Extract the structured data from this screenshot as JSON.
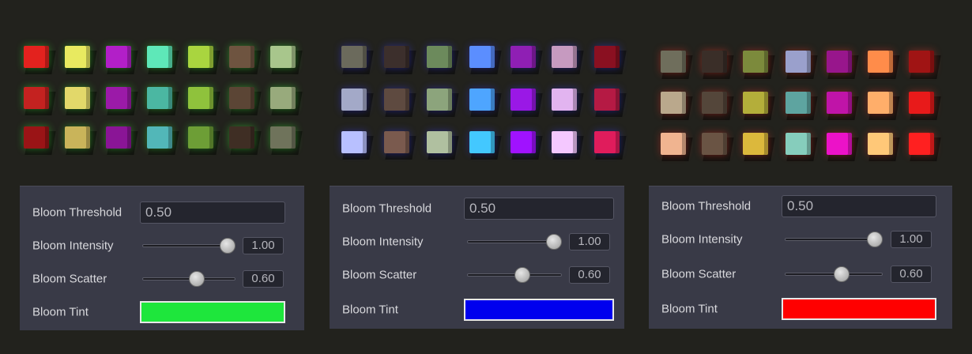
{
  "panels": [
    {
      "bloom_threshold": {
        "label": "Bloom Threshold",
        "value": "0.50"
      },
      "bloom_intensity": {
        "label": "Bloom Intensity",
        "value": "1.00",
        "fraction": 1.0
      },
      "bloom_scatter": {
        "label": "Bloom Scatter",
        "value": "0.60",
        "fraction": 0.6
      },
      "bloom_tint": {
        "label": "Bloom Tint",
        "color": "#1ee63c"
      },
      "cube_colors": [
        [
          "#e3221e",
          "#e8ea60",
          "#b21fc8",
          "#5ee8b8",
          "#a9d53f",
          "#6e5440",
          "#a8c68c"
        ],
        [
          "#c42220",
          "#e2d86a",
          "#9b1aa8",
          "#4bb7a2",
          "#8fc23c",
          "#5b4535",
          "#98aa7c"
        ],
        [
          "#9a1416",
          "#c9b45a",
          "#8a1596",
          "#52b7b8",
          "#6d9e36",
          "#3f2e24",
          "#6f735b"
        ]
      ],
      "glow": "#43ff3a"
    },
    {
      "bloom_threshold": {
        "label": "Bloom Threshold",
        "value": "0.50"
      },
      "bloom_intensity": {
        "label": "Bloom Intensity",
        "value": "1.00",
        "fraction": 1.0
      },
      "bloom_scatter": {
        "label": "Bloom Scatter",
        "value": "0.60",
        "fraction": 0.6
      },
      "bloom_tint": {
        "label": "Bloom Tint",
        "color": "#0000ee"
      },
      "cube_colors": [
        [
          "#6b6a5c",
          "#3c2f2c",
          "#6c8a5c",
          "#5b8eff",
          "#8f1fb4",
          "#c69ac0",
          "#8a1021"
        ],
        [
          "#a3a9c8",
          "#5e4a40",
          "#8ca47c",
          "#4ea5ff",
          "#9a18e6",
          "#e2b4f0",
          "#b51a44"
        ],
        [
          "#b8c0ff",
          "#7a5a4e",
          "#b0c0a0",
          "#43c8ff",
          "#a012ff",
          "#f4c8ff",
          "#e01c5c"
        ]
      ],
      "glow": "#3a3cff"
    },
    {
      "bloom_threshold": {
        "label": "Bloom Threshold",
        "value": "0.50"
      },
      "bloom_intensity": {
        "label": "Bloom Intensity",
        "value": "1.00",
        "fraction": 1.0
      },
      "bloom_scatter": {
        "label": "Bloom Scatter",
        "value": "0.60",
        "fraction": 0.6
      },
      "bloom_tint": {
        "label": "Bloom Tint",
        "color": "#ff0000"
      },
      "cube_colors": [
        [
          "#6f6e5c",
          "#3a2e28",
          "#7c8a3c",
          "#9aa0cc",
          "#98168c",
          "#ff8c4a",
          "#a01414"
        ],
        [
          "#baa88c",
          "#54463a",
          "#b4ae3a",
          "#5ea4a0",
          "#c014a8",
          "#ffae6a",
          "#e81a1a"
        ],
        [
          "#f0b490",
          "#6a5444",
          "#dcb83c",
          "#86cdbc",
          "#ec12c8",
          "#ffc878",
          "#ff2020"
        ]
      ],
      "glow": "#ff3a2a"
    }
  ]
}
